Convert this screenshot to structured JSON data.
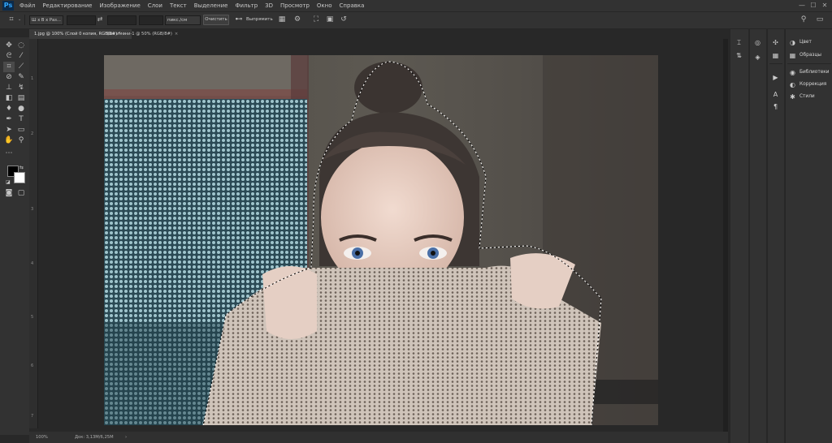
{
  "app": {
    "logo": "Ps"
  },
  "menu": [
    "Файл",
    "Редактирование",
    "Изображение",
    "Слои",
    "Текст",
    "Выделение",
    "Фильтр",
    "3D",
    "Просмотр",
    "Окно",
    "Справка"
  ],
  "window_controls": {
    "minimize": "—",
    "maximize": "☐",
    "close": "✕"
  },
  "options": {
    "style_value": "Ш х В х Раз...",
    "units_value": "пикс./см",
    "clear_label": "Очистить",
    "straighten_label": "Выпрямить"
  },
  "tabs": [
    {
      "label": "1.jpg @ 100% (Слой 0 копия, RGB/8#) *",
      "close": "×",
      "active": true
    },
    {
      "label": "Без имени-1 @ 50% (RGB/8#)",
      "close": "×",
      "active": false
    }
  ],
  "ruler_left": [
    "1",
    "2",
    "3",
    "4",
    "5",
    "6",
    "7"
  ],
  "status": {
    "zoom": "100%",
    "doc": "Док: 3,13M/6,25M",
    "arrow": "›"
  },
  "panels": {
    "group1": [
      {
        "icon": "color-wheel-icon",
        "label": "Цвет"
      },
      {
        "icon": "swatches-grid-icon",
        "label": "Образцы"
      }
    ],
    "group2": [
      {
        "icon": "libraries-icon",
        "label": "Библиотеки"
      },
      {
        "icon": "adjustments-icon",
        "label": "Коррекция"
      },
      {
        "icon": "styles-icon",
        "label": "Стили"
      }
    ]
  },
  "colors": {
    "accent": "#31a8ff",
    "chrome": "#323232",
    "canvas_bg": "#282828",
    "foreground": "#000000",
    "background": "#ffffff"
  }
}
